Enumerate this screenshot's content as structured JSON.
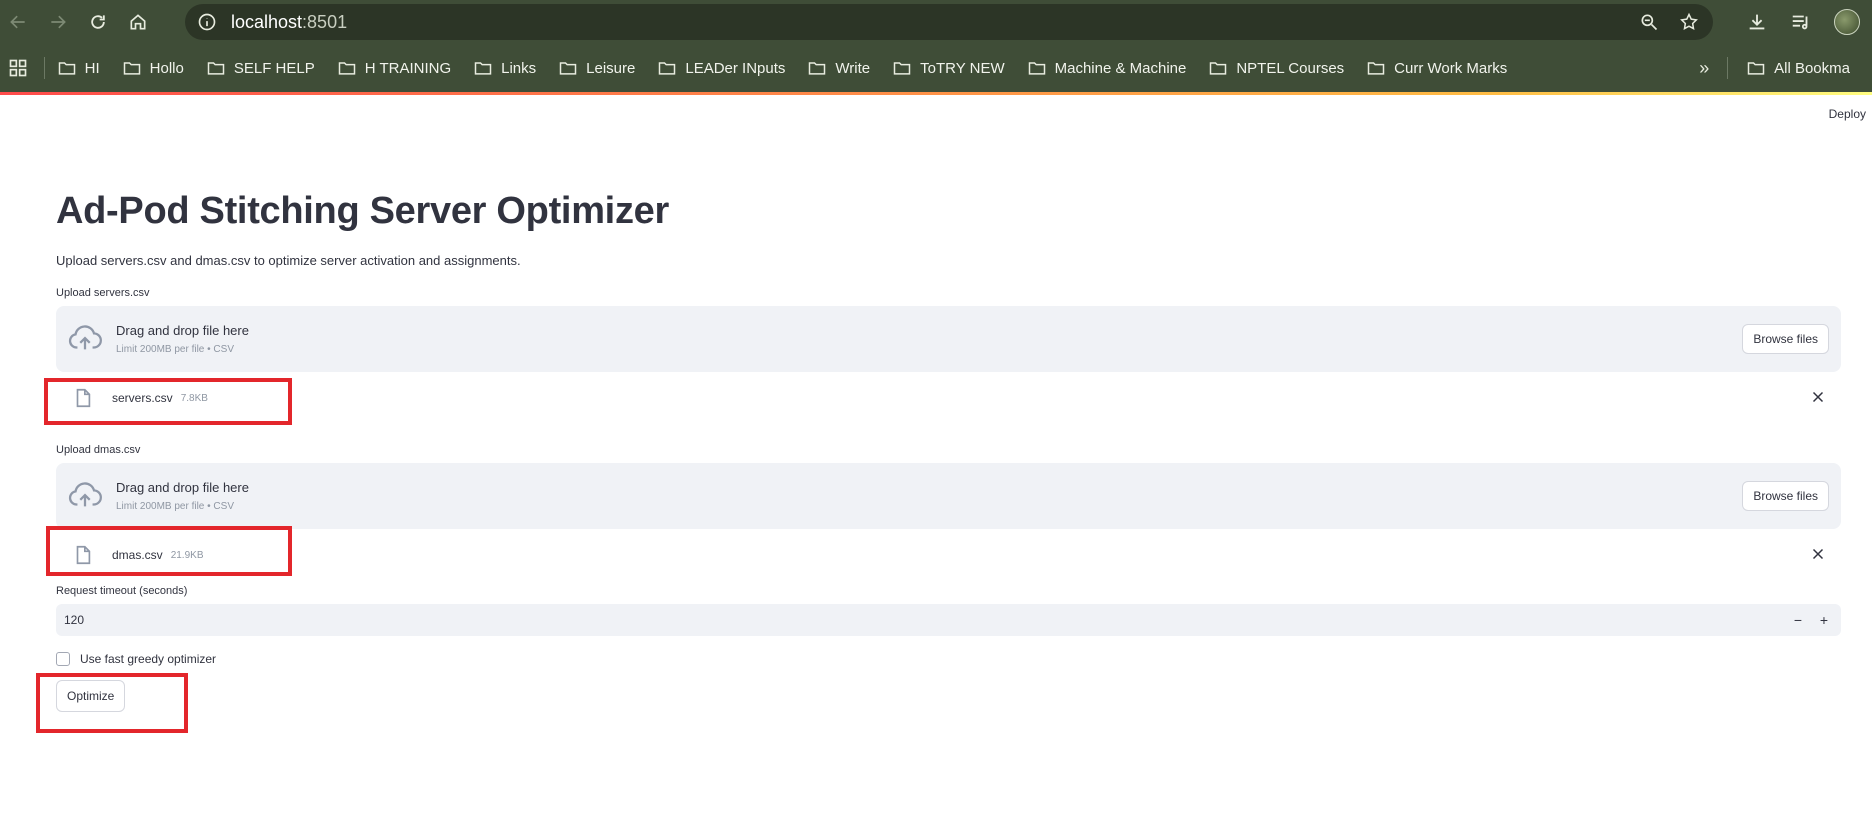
{
  "browser": {
    "url_host": "localhost",
    "url_port": ":8501",
    "icons": [
      "back-icon",
      "forward-icon",
      "reload-icon",
      "home-icon",
      "site-info-icon",
      "zoom-icon",
      "star-icon",
      "download-icon",
      "media-queue-icon"
    ]
  },
  "bookmarks": {
    "items": [
      "HI",
      "Hollo",
      "SELF HELP",
      "H TRAINING",
      "Links",
      "Leisure",
      "LEADer INputs",
      "Write",
      "ToTRY NEW",
      "Machine & Machine",
      "NPTEL Courses",
      "Curr Work Marks"
    ],
    "more": "»",
    "all_bookmarks": "All Bookma"
  },
  "app": {
    "deploy_label": "Deploy",
    "title": "Ad-Pod Stitching Server Optimizer",
    "subtitle": "Upload servers.csv and dmas.csv to optimize server activation and assignments.",
    "uploaders": [
      {
        "label": "Upload servers.csv",
        "drop_text": "Drag and drop file here",
        "limit_text": "Limit 200MB per file • CSV",
        "browse_label": "Browse files",
        "file_name": "servers.csv",
        "file_size": "7.8KB"
      },
      {
        "label": "Upload dmas.csv",
        "drop_text": "Drag and drop file here",
        "limit_text": "Limit 200MB per file • CSV",
        "browse_label": "Browse files",
        "file_name": "dmas.csv",
        "file_size": "21.9KB"
      }
    ],
    "timeout": {
      "label": "Request timeout (seconds)",
      "value": "120",
      "minus": "−",
      "plus": "+"
    },
    "greedy_checkbox": {
      "label": "Use fast greedy optimizer",
      "checked": false
    },
    "optimize_label": "Optimize"
  },
  "colors": {
    "chrome_bg": "#3f4d37",
    "highlight": "#e3262b",
    "input_bg": "#f0f2f6",
    "text": "#31333f"
  }
}
